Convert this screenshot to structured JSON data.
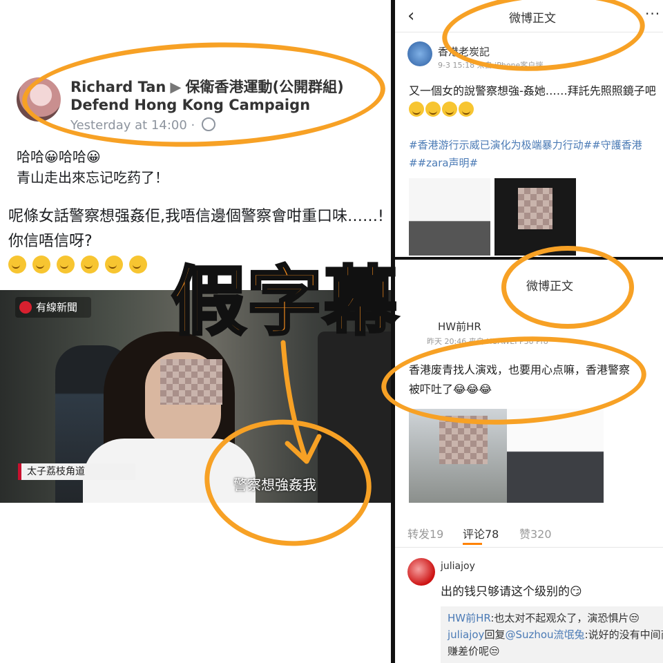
{
  "facebook": {
    "author": "Richard Tan",
    "group": "保衛香港運動(公開群組)",
    "group_en": "Defend Hong Kong Campaign",
    "timestamp": "Yesterday at 14:00",
    "post_line1": "哈哈😀哈哈😀",
    "post_line2": "青山走出來忘记吃药了！",
    "caption": "呢條女話警察想强姦佢,我唔信邊個警察會咁重口味……!你信唔信呀?",
    "video": {
      "channel_logo": "有線新聞",
      "location": "太子荔枝角道",
      "subtitle": "警察想強姦我"
    }
  },
  "weibo": {
    "header_title": "微博正文",
    "post1": {
      "user": "香港老炭記",
      "meta": "9-3 15:18 来自 iPhone客户端",
      "text": "又一個女的說警察想強-姦她……拜託先照照鏡子吧",
      "tags": "#香港游行示威已演化为极端暴力行动##守護香港##zara声明#"
    },
    "post2": {
      "header_title": "微博正文",
      "user": "HW前HR",
      "meta": "昨天 20:46 来自 HUAWEI P30 Pro",
      "text_line1": "香港废青找人演戏，也要用心点嘛，香港警察",
      "text_line2": "被吓吐了😂😂😂"
    },
    "actions": {
      "repost": "转发19",
      "comments": "评论78",
      "likes": "赞320"
    },
    "comment": {
      "user": "juliajoy",
      "text": "出的钱只够请这个级别的😏",
      "reply1_user": "HW前HR",
      "reply1_text": ":也太对不起观众了，演恐惧片😒",
      "reply2_user": "juliajoy",
      "reply2_mid": "回复",
      "reply2_to": "@Suzhou流氓兔",
      "reply2_text": ":说好的没有中间商",
      "reply2_line2": "赚差价呢😒"
    }
  },
  "annotation": {
    "stamp": "假字幕",
    "color": "#f7a125"
  }
}
